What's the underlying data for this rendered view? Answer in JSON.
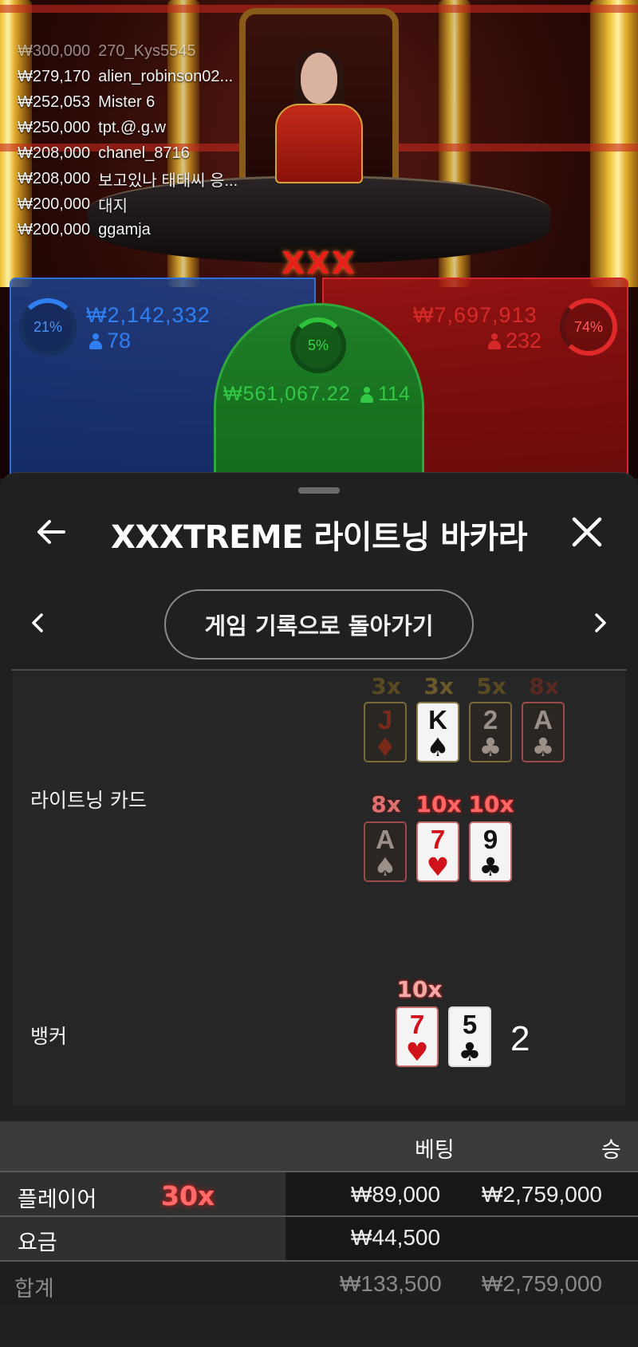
{
  "winners": [
    {
      "amount": "₩300,000",
      "name": "270_Kys5545"
    },
    {
      "amount": "₩279,170",
      "name": "alien_robinson02..."
    },
    {
      "amount": "₩252,053",
      "name": "Mister 6"
    },
    {
      "amount": "₩250,000",
      "name": "tpt.@.g.w"
    },
    {
      "amount": "₩208,000",
      "name": "chanel_8716"
    },
    {
      "amount": "₩208,000",
      "name": "보고있나 태태씨 응..."
    },
    {
      "amount": "₩200,000",
      "name": "대지"
    },
    {
      "amount": "₩200,000",
      "name": "ggamja"
    }
  ],
  "table_logo": "XXX",
  "bet_areas": {
    "player": {
      "percent": "21%",
      "total": "₩2,142,332",
      "players": "78",
      "color": "#2f7ff0"
    },
    "tie": {
      "percent": "5%",
      "total": "₩561,067.22",
      "players": "114",
      "color": "#2ec23a"
    },
    "banker": {
      "percent": "74%",
      "total": "₩7,697,913",
      "players": "232",
      "color": "#e02a2a"
    }
  },
  "sheet": {
    "title": "XXXTREME 라이트닝 바카라",
    "back_icon": "arrow-left-icon",
    "close_icon": "close-icon",
    "history_button": "게임 기록으로 돌아가기",
    "prev_icon": "chevron-left-icon",
    "next_icon": "chevron-right-icon"
  },
  "lightning": {
    "label": "라이트닝 카드",
    "row1": [
      {
        "mult": "3x",
        "rank": "J",
        "suit": "♦",
        "color": "red",
        "state": "dim"
      },
      {
        "mult": "3x",
        "rank": "K",
        "suit": "♠",
        "color": "black",
        "state": "lit"
      },
      {
        "mult": "5x",
        "rank": "2",
        "suit": "♣",
        "color": "black",
        "state": "dim"
      },
      {
        "mult": "8x",
        "rank": "A",
        "suit": "♣",
        "color": "black",
        "state": "dim"
      }
    ],
    "row2": [
      {
        "mult": "8x",
        "rank": "A",
        "suit": "♠",
        "color": "black",
        "state": "dim"
      },
      {
        "mult": "10x",
        "rank": "7",
        "suit": "♥",
        "color": "red",
        "state": "lit"
      },
      {
        "mult": "10x",
        "rank": "9",
        "suit": "♣",
        "color": "black",
        "state": "lit"
      }
    ]
  },
  "banker": {
    "label": "뱅커",
    "cards": [
      {
        "mult": "10x",
        "rank": "7",
        "suit": "♥",
        "color": "red"
      },
      {
        "mult": "",
        "rank": "5",
        "suit": "♣",
        "color": "black"
      }
    ],
    "score": "2"
  },
  "bets_table": {
    "headers": {
      "bet": "베팅",
      "win": "승"
    },
    "rows": [
      {
        "label": "플레이어",
        "mult": "30x",
        "bet": "₩89,000",
        "win": "₩2,759,000"
      },
      {
        "label": "요금",
        "mult": "",
        "bet": "₩44,500",
        "win": ""
      }
    ],
    "total": {
      "label": "합계",
      "bet": "₩133,500",
      "win": "₩2,759,000"
    }
  }
}
